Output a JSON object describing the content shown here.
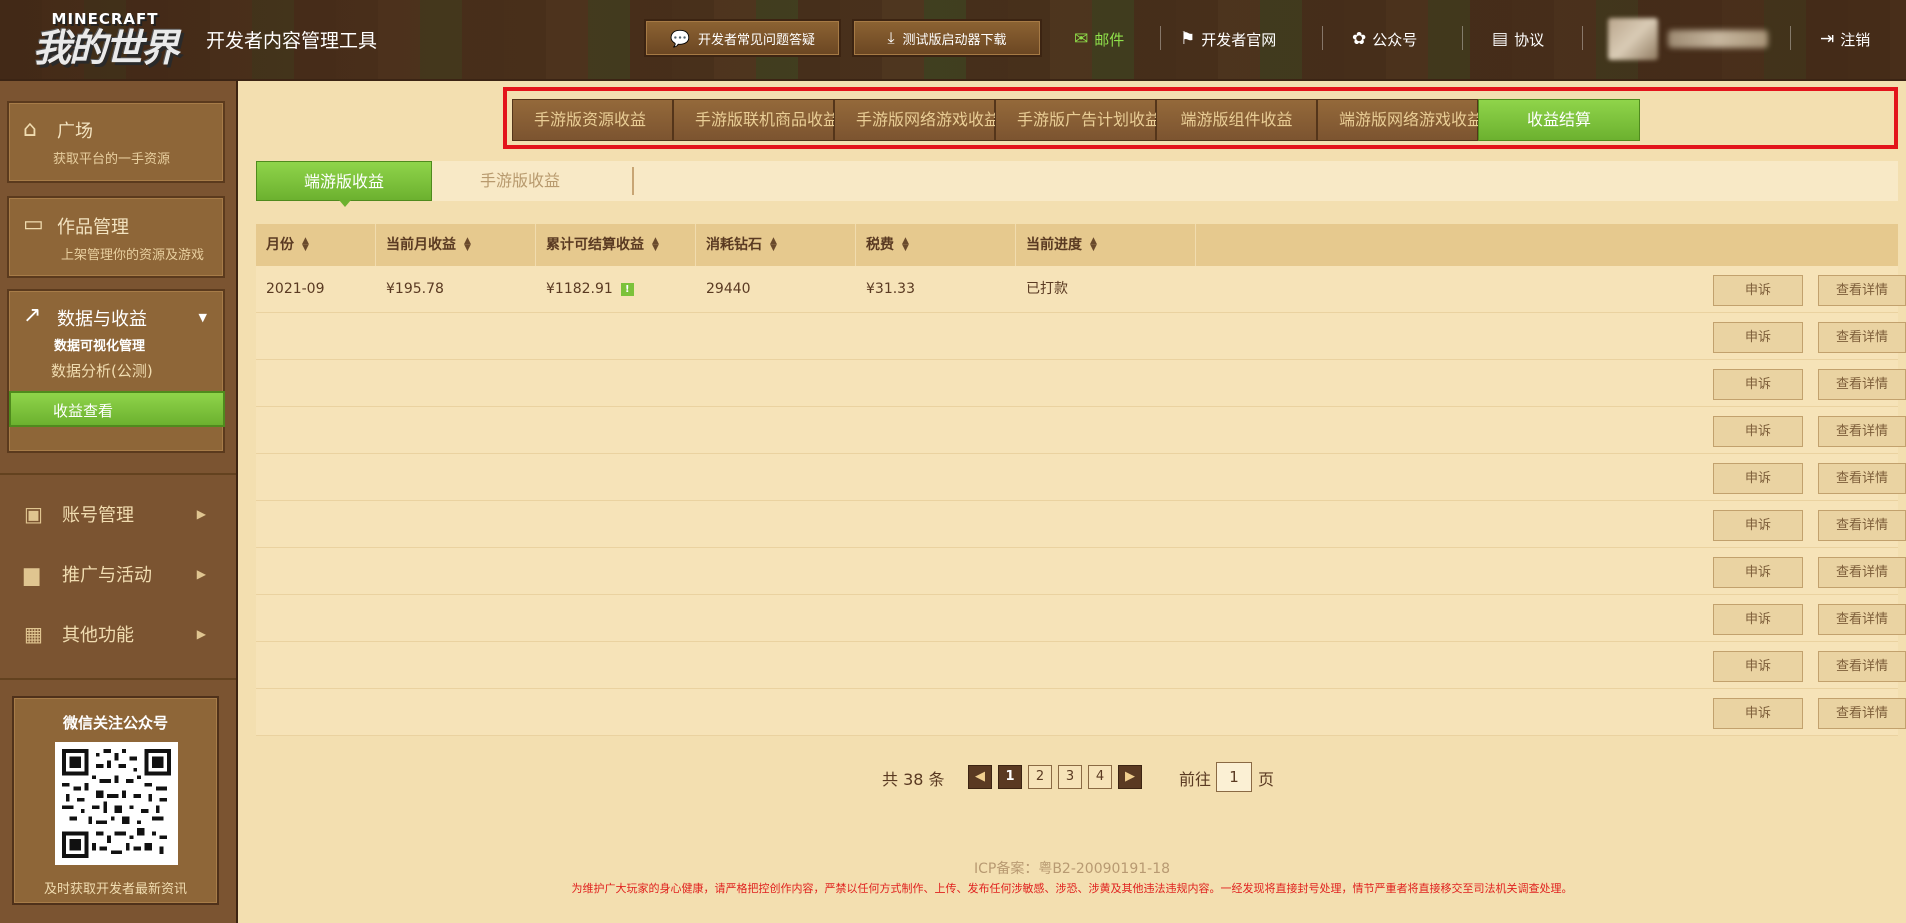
{
  "header": {
    "logo_en": "MINECRAFT",
    "logo_cn": "我的世界",
    "app_title": "开发者内容管理工具",
    "faq_button": "开发者常见问题答疑",
    "download_button": "测试版启动器下载",
    "links": {
      "mail": "邮件",
      "official_site": "开发者官网",
      "wechat_account": "公众号",
      "agreement": "协议",
      "logout": "注销"
    }
  },
  "sidebar": {
    "plaza": {
      "title": "广场",
      "sub": "获取平台的一手资源"
    },
    "works": {
      "title": "作品管理",
      "sub": "上架管理你的资源及游戏"
    },
    "data": {
      "title": "数据与收益",
      "sub": "数据可视化管理",
      "items": [
        {
          "label": "数据分析(公测)"
        },
        {
          "label": "收益查看"
        }
      ]
    },
    "menus": [
      {
        "label": "账号管理"
      },
      {
        "label": "推广与活动"
      },
      {
        "label": "其他功能"
      }
    ],
    "wechat": {
      "title": "微信关注公众号",
      "bottom": "及时获取开发者最新资讯"
    }
  },
  "top_tabs": [
    {
      "label": "手游版资源收益"
    },
    {
      "label": "手游版联机商品收益"
    },
    {
      "label": "手游版网络游戏收益"
    },
    {
      "label": "手游版广告计划收益"
    },
    {
      "label": "端游版组件收益"
    },
    {
      "label": "端游版网络游戏收益"
    },
    {
      "label": "收益结算"
    }
  ],
  "sub_tabs": [
    {
      "label": "端游版收益"
    },
    {
      "label": "手游版收益"
    }
  ],
  "table": {
    "headers": [
      "月份",
      "当前月收益",
      "累计可结算收益",
      "消耗钻石",
      "税费",
      "当前进度"
    ],
    "rows": [
      {
        "month": "2021-09",
        "current": "¥195.78",
        "cumulative": "¥1182.91",
        "diamonds": "29440",
        "tax": "¥31.33",
        "progress": "已打款"
      }
    ],
    "appeal_label": "申诉",
    "detail_label": "查看详情",
    "badge": "!"
  },
  "pager": {
    "total": "共 38 条",
    "pages": [
      "1",
      "2",
      "3",
      "4"
    ],
    "goto_label": "前往",
    "goto_value": "1",
    "page_label": "页"
  },
  "footer": {
    "icp": "ICP备案：粤B2-20090191-18",
    "warning": "为维护广大玩家的身心健康，请严格把控创作内容，严禁以任何方式制作、上传、发布任何涉敏感、涉恐、涉黄及其他违法违规内容。一经发现将直接封号处理，情节严重者将直接移交至司法机关调查处理。"
  },
  "colors": {
    "accent_green": "#7cc23a",
    "brown": "#7b5431",
    "highlight_red": "#e3141b"
  }
}
